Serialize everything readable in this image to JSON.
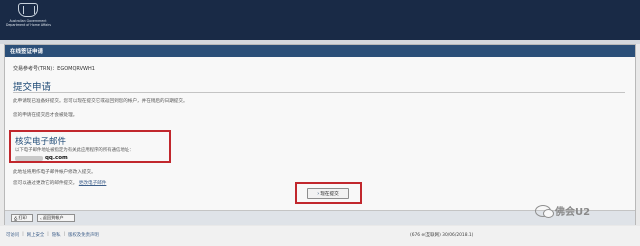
{
  "header": {
    "crest_line1": "Australian Government",
    "crest_line2": "Department of Home Affairs"
  },
  "panel": {
    "title": "在线签证申请",
    "trn_text": "交易参考号(TRN)：EGOMQRVWH1"
  },
  "submit_section": {
    "heading": "提交申请",
    "line1": "此申请现已准备好提交。您可以现在提交它或返回到您的帐户，并在稍后的日期提交。",
    "line2": "您的申请在提交后才会被处理。"
  },
  "email_section": {
    "heading": "核实电子邮件",
    "desc": "以下电子邮件地址被指定为有关此应用程序的所有通信地址：",
    "email_domain": "qq.com"
  },
  "extra": {
    "line1": "此地址将用作电子邮件帐户修改入提交。",
    "line2": "您可以通过更改它的邮件提交。",
    "line2_link": "更改电子邮件"
  },
  "buttons": {
    "submit": "现在提交",
    "print": "打印",
    "return_account": "返回到帐户"
  },
  "footer": {
    "links": [
      "可访问",
      "网上安全",
      "隐私",
      "版权及免责声明"
    ],
    "info": "(676 e(互联网) 30/06/2018.1)"
  },
  "watermark": {
    "text": "佛会U2"
  }
}
